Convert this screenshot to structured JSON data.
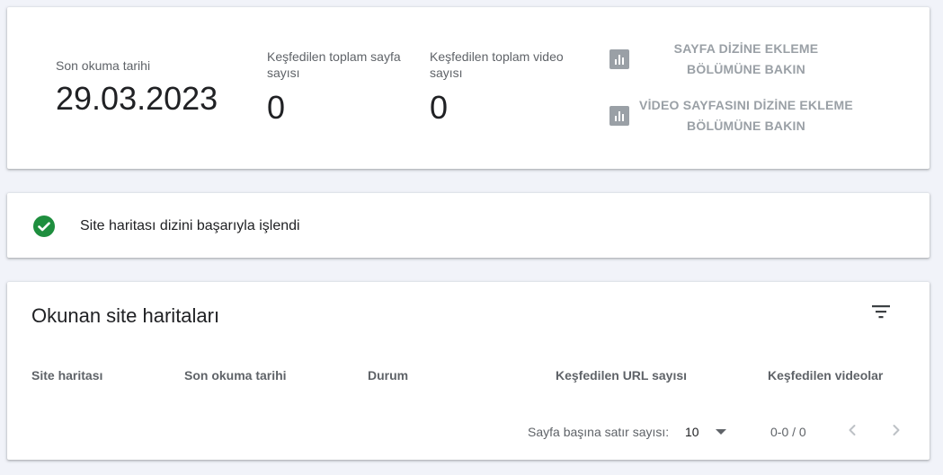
{
  "summary": {
    "last_read_label": "Son okuma tarihi",
    "last_read_value": "29.03.2023",
    "pages_label": "Keşfedilen toplam sayfa sayısı",
    "pages_value": "0",
    "videos_label": "Keşfedilen toplam video sayısı",
    "videos_value": "0",
    "links": [
      {
        "label": "SAYFA DİZİNE EKLEME BÖLÜMÜNE BAKIN",
        "icon": "bar-chart-icon"
      },
      {
        "label": "VİDEO SAYFASINI DİZİNE EKLEME BÖLÜMÜNE BAKIN",
        "icon": "bar-chart-icon"
      }
    ]
  },
  "status": {
    "icon": "check-circle-icon",
    "text": "Site haritası dizini başarıyla işlendi",
    "color": "#1e8e3e"
  },
  "table": {
    "title": "Okunan site haritaları",
    "filter_icon": "filter-icon",
    "columns": [
      "Site haritası",
      "Son okuma tarihi",
      "Durum",
      "Keşfedilen URL sayısı",
      "Keşfedilen videolar"
    ],
    "rows": [],
    "pagination": {
      "rows_label": "Sayfa başına satır sayısı:",
      "rows_per_page": "10",
      "range": "0-0 / 0"
    }
  }
}
